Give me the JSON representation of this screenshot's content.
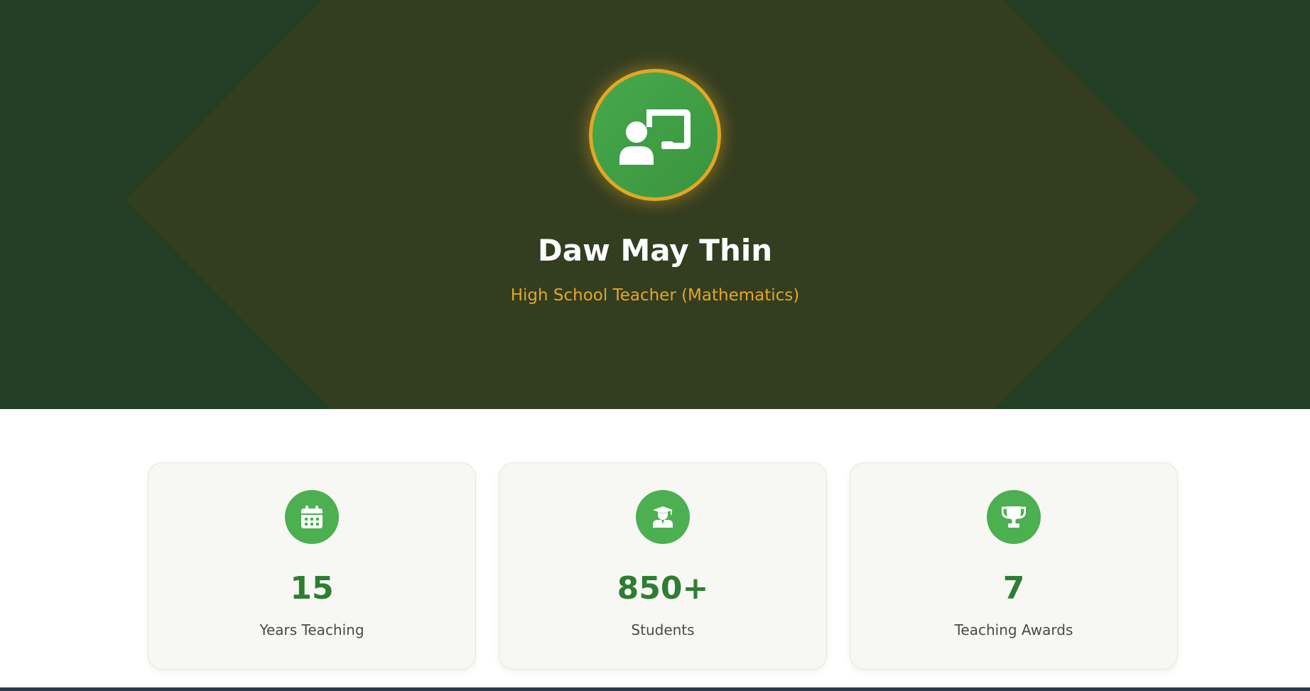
{
  "profile": {
    "name": "Daw May Thin",
    "role": "High School Teacher (Mathematics)",
    "avatar_icon": "teacher-chalkboard-icon"
  },
  "stats": [
    {
      "icon": "calendar-icon",
      "value": "15",
      "label": "Years Teaching"
    },
    {
      "icon": "graduate-student-icon",
      "value": "850+",
      "label": "Students"
    },
    {
      "icon": "trophy-icon",
      "value": "7",
      "label": "Teaching Awards"
    }
  ],
  "colors": {
    "hero_background": "#223e25",
    "hero_accent": "#333d20",
    "gold": "#e3a725",
    "green": "#4caf50",
    "stat_value": "#2e7d32"
  }
}
